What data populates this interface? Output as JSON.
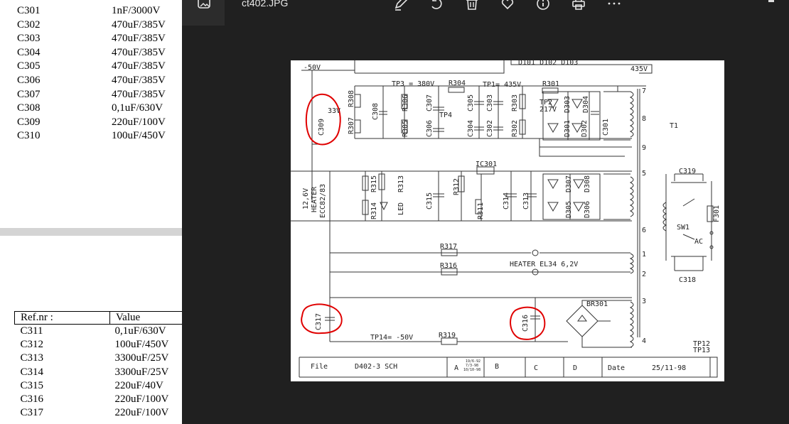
{
  "window": {
    "file_name": "ct402.JPG"
  },
  "toolbar": {
    "icons": [
      "image-icon",
      "edit-icon",
      "rotate-icon",
      "delete-icon",
      "favorite-icon",
      "info-icon",
      "print-icon",
      "more-icon"
    ]
  },
  "document": {
    "parts_top": [
      {
        "ref": "C301",
        "value": "1nF/3000V"
      },
      {
        "ref": "C302",
        "value": "470uF/385V"
      },
      {
        "ref": "C303",
        "value": "470uF/385V"
      },
      {
        "ref": "C304",
        "value": "470uF/385V"
      },
      {
        "ref": "C305",
        "value": "470uF/385V"
      },
      {
        "ref": "C306",
        "value": "470uF/385V"
      },
      {
        "ref": "C307",
        "value": "470uF/385V"
      },
      {
        "ref": "C308",
        "value": "0,1uF/630V"
      },
      {
        "ref": "C309",
        "value": "220uF/100V"
      },
      {
        "ref": "C310",
        "value": "100uF/450V"
      }
    ],
    "table": {
      "headers": [
        "Ref.nr :",
        "Value"
      ],
      "rows": [
        {
          "ref": "C311",
          "value": "0,1uF/630V"
        },
        {
          "ref": "C312",
          "value": "100uF/450V"
        },
        {
          "ref": "C313",
          "value": "3300uF/25V"
        },
        {
          "ref": "C314",
          "value": "3300uF/25V"
        },
        {
          "ref": "C315",
          "value": "220uF/40V"
        },
        {
          "ref": "C316",
          "value": "220uF/100V"
        },
        {
          "ref": "C317",
          "value": "220uF/100V"
        }
      ]
    }
  },
  "schematic": {
    "labels": {
      "neg50": "-50V",
      "d101": "D101 D102 D103",
      "v435": "435V",
      "tp3": "TP3 = 380V",
      "r304": "R304",
      "tp1": "TP1= 435V",
      "r301": "R301",
      "r308": "R308",
      "r307": "R307",
      "c309": "C309",
      "v33": "33V",
      "c308": "C308",
      "r306": "R306",
      "r305": "R305",
      "c307": "C307",
      "c306": "C306",
      "tp4": "TP4",
      "c305": "C305",
      "c304": "C304",
      "c303": "C303",
      "c302": "C302",
      "r303": "R303",
      "r302": "R302",
      "tp2": "TP2",
      "v217": "217V",
      "d303": "D303",
      "d304": "D304",
      "d301": "D301",
      "d302": "D302",
      "c301": "C301",
      "t1": "T1",
      "p7": "7",
      "p8": "8",
      "p9": "9",
      "p5": "5",
      "p6": "6",
      "p1": "1",
      "p2": "2",
      "p3": "3",
      "p4": "4",
      "ic301": "IC301",
      "r315": "R315",
      "r314": "R314",
      "r313": "R313",
      "led": "LED",
      "c315": "C315",
      "r312": "R312",
      "r311": "R311",
      "c314": "C314",
      "c313": "C313",
      "d307": "D307",
      "d308": "D308",
      "d305": "D305",
      "d306": "D306",
      "heater_a": "12,6V",
      "heater_b": "HEATER",
      "heater_c": "ECC82/83",
      "c319": "C319",
      "f301": "F301",
      "sw1": "SW1",
      "ac": "AC",
      "c318": "C318",
      "r317": "R317",
      "r316": "R316",
      "heater_el34": "HEATER  EL34  6,2V",
      "br301": "BR301",
      "c317": "C317",
      "c316": "C316",
      "tp14": "TP14= -50V",
      "r319": "R319",
      "tp12": "TP12",
      "tp13": "TP13",
      "file_label": "File",
      "file_value": "D402-3 SCH",
      "rev_a": "A",
      "rev_b": "B",
      "rev_c": "C",
      "rev_d": "D",
      "rev_dates_1": "19/6-92",
      "rev_dates_2": "7/3-98",
      "rev_dates_3": "10/10-98",
      "date_label": "Date",
      "date_value": "25/11-98"
    },
    "highlight_color": "#e00000"
  }
}
